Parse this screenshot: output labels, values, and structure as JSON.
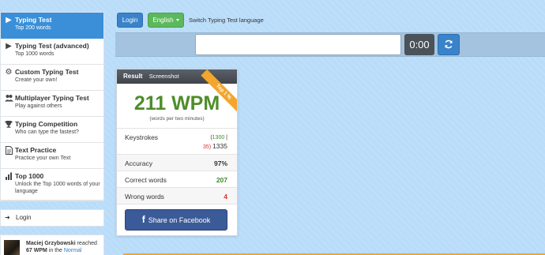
{
  "sidebar": {
    "items": [
      {
        "title": "Typing Test",
        "subtitle": "Top 200 words",
        "icon": "play-icon"
      },
      {
        "title": "Typing Test (advanced)",
        "subtitle": "Top 1000 words",
        "icon": "play-icon"
      },
      {
        "title": "Custom Typing Test",
        "subtitle": "Create your own!",
        "icon": "gears-icon"
      },
      {
        "title": "Multiplayer Typing Test",
        "subtitle": "Play against others",
        "icon": "users-icon"
      },
      {
        "title": "Typing Competition",
        "subtitle": "Who can type the fastest?",
        "icon": "trophy-icon"
      },
      {
        "title": "Text Practice",
        "subtitle": "Practice your own Text",
        "icon": "file-icon"
      },
      {
        "title": "Top 1000",
        "subtitle": "Unlock the Top 1000 words of your language",
        "icon": "bar-chart-icon"
      }
    ],
    "login": "Login",
    "activity": {
      "name": "Maciej Grzybowski",
      "reached": "reached",
      "wpm": "67 WPM",
      "in_the": "in the",
      "mode": "Normal"
    }
  },
  "toolbar": {
    "login_label": "Login",
    "language_label": "English",
    "switch_text": "Switch Typing Test language"
  },
  "typing": {
    "input_value": "",
    "timer": "0:00"
  },
  "result": {
    "tab_result": "Result",
    "tab_screenshot": "Screenshot",
    "badge": "Top 1 %",
    "wpm": "211 WPM",
    "wpm_sub": "(words per two minutes)",
    "keystrokes_label": "Keystrokes",
    "keystrokes_correct": "1300",
    "keystrokes_wrong": "35",
    "keystrokes_total": "1335",
    "accuracy_label": "Accuracy",
    "accuracy_value": "97%",
    "correct_label": "Correct words",
    "correct_value": "207",
    "wrong_label": "Wrong words",
    "wrong_value": "4",
    "share_label": "Share on Facebook"
  },
  "colors": {
    "accent": "#3a8fd8",
    "wpm": "#4f8d2a",
    "error": "#d9302c",
    "badge": "#f4a52c",
    "facebook": "#3b5a98"
  }
}
